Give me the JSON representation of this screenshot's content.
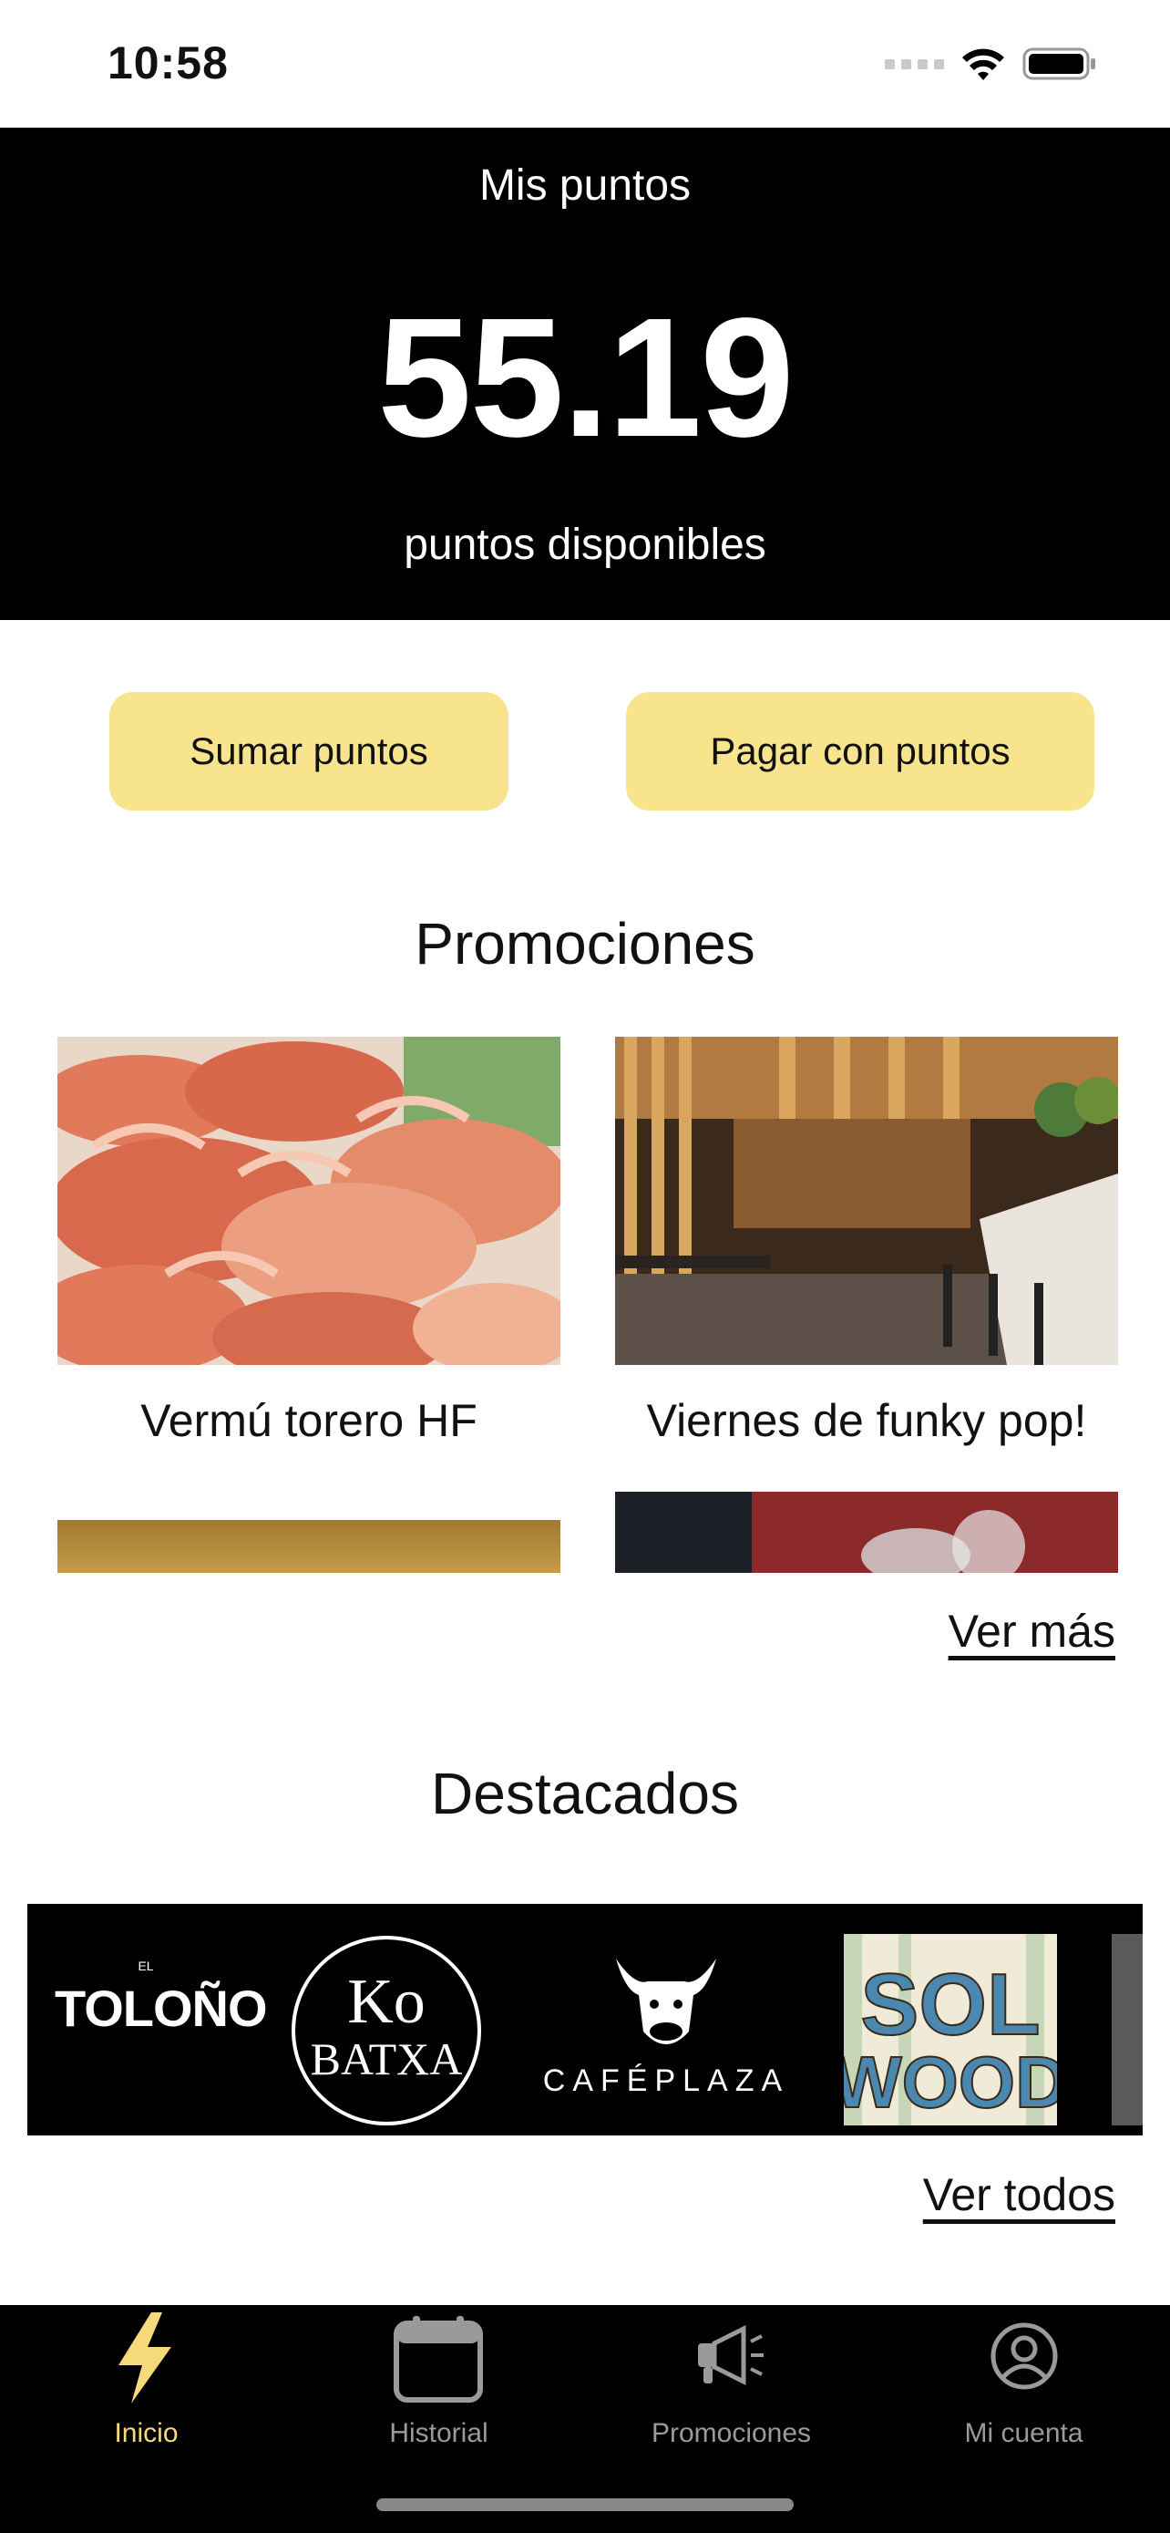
{
  "status_bar": {
    "time": "10:58"
  },
  "points": {
    "title": "Mis puntos",
    "value": "55.19",
    "subtitle": "puntos disponibles"
  },
  "actions": {
    "sumar_label": "Sumar puntos",
    "pagar_label": "Pagar con puntos"
  },
  "promotions": {
    "title": "Promociones",
    "items": [
      {
        "label": "Vermú torero HF"
      },
      {
        "label": "Viernes de funky pop!"
      }
    ],
    "more_label": "Ver más"
  },
  "featured": {
    "title": "Destacados",
    "logos": [
      {
        "name": "TOLOÑO"
      },
      {
        "name_line1": "Ko",
        "name_line2": "BATXA"
      },
      {
        "name": "CAFÉPLAZA"
      },
      {
        "name": "SOLWOOD"
      }
    ],
    "all_label": "Ver todos"
  },
  "tabbar": {
    "items": [
      {
        "label": "Inicio",
        "icon": "bolt-icon",
        "active": true
      },
      {
        "label": "Historial",
        "icon": "calendar-icon"
      },
      {
        "label": "Promociones",
        "icon": "megaphone-icon"
      },
      {
        "label": "Mi cuenta",
        "icon": "user-circle-icon"
      }
    ]
  },
  "colors": {
    "accent": "#f8e48d",
    "active_tab": "#f5d97a",
    "header_bg": "#000000"
  }
}
